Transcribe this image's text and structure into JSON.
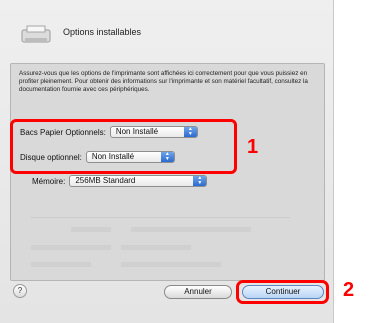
{
  "dialog": {
    "title": "Options installables",
    "description": "Assurez-vous que les options de l'imprimante sont affichées ici correctement pour que vous puissiez en profiter pleinement. Pour obtenir des informations sur l'imprimante et son matériel facultatif, consultez la documentation fournie avec ces périphériques."
  },
  "options": {
    "bacs_label": "Bacs Papier Optionnels:",
    "bacs_value": "Non Installé",
    "disque_label": "Disque optionnel:",
    "disque_value": "Non Installé",
    "memoire_label": "Mémoire:",
    "memoire_value": "256MB Standard"
  },
  "callouts": {
    "one": "1",
    "two": "2"
  },
  "footer": {
    "help": "?",
    "cancel_label": "Annuler",
    "continue_label": "Continuer"
  },
  "colors": {
    "callout": "#ff0000",
    "popup_accent": "#2b6bd1"
  },
  "icons": [
    "printer-icon",
    "popup-arrows-icon",
    "help-icon"
  ]
}
